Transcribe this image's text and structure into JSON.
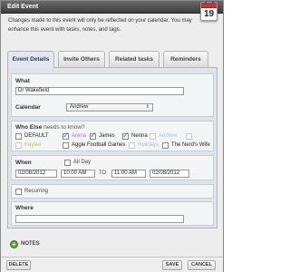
{
  "window": {
    "title": "Edit Event",
    "calendar_day": "19"
  },
  "intro_text": "Changes made to this event will only be reflected on your calendar. You may enhance this event with tasks, notes, and tags.",
  "tabs": [
    {
      "label": "Event Details",
      "active": true
    },
    {
      "label": "Invite Others",
      "active": false
    },
    {
      "label": "Related tasks",
      "active": false
    },
    {
      "label": "Reminders",
      "active": false
    }
  ],
  "what": {
    "label": "What",
    "value": "Dr Wakefield"
  },
  "calendar": {
    "label": "Calendar",
    "selected": "Andrew"
  },
  "who_else": {
    "label": "Who Else",
    "label_suffix": "needs to know?",
    "people": [
      {
        "name": "DEFAULT",
        "checked": false,
        "color": "#222222"
      },
      {
        "name": "Arena",
        "checked": true,
        "color": "#c56bd6"
      },
      {
        "name": "James",
        "checked": true,
        "color": "#222222"
      },
      {
        "name": "Nenna",
        "checked": true,
        "color": "#222222"
      },
      {
        "name": "Andrew",
        "checked": false,
        "color": "#9fc2e4"
      },
      {
        "name": "Kaylee",
        "checked": false,
        "color": "#b0c94a"
      },
      {
        "name": "Aggie Football Games",
        "checked": false,
        "color": "#222222"
      },
      {
        "name": "Holidays",
        "checked": false,
        "color": "#9fc2e4"
      },
      {
        "name": "The Nerd's Wife",
        "checked": false,
        "color": "#222222"
      }
    ]
  },
  "when": {
    "label": "When",
    "all_day_label": "All Day",
    "start_date": "02/08/2012",
    "start_time": "10:00 AM",
    "to_label": "TO",
    "end_time": "11:00 AM",
    "end_date": "02/08/2012"
  },
  "recurring": {
    "label": "Recurring"
  },
  "where": {
    "label": "Where",
    "value": ""
  },
  "notes": {
    "label": "NOTES"
  },
  "buttons": {
    "delete": "DELETE",
    "save": "SAVE",
    "cancel": "CANCEL"
  }
}
